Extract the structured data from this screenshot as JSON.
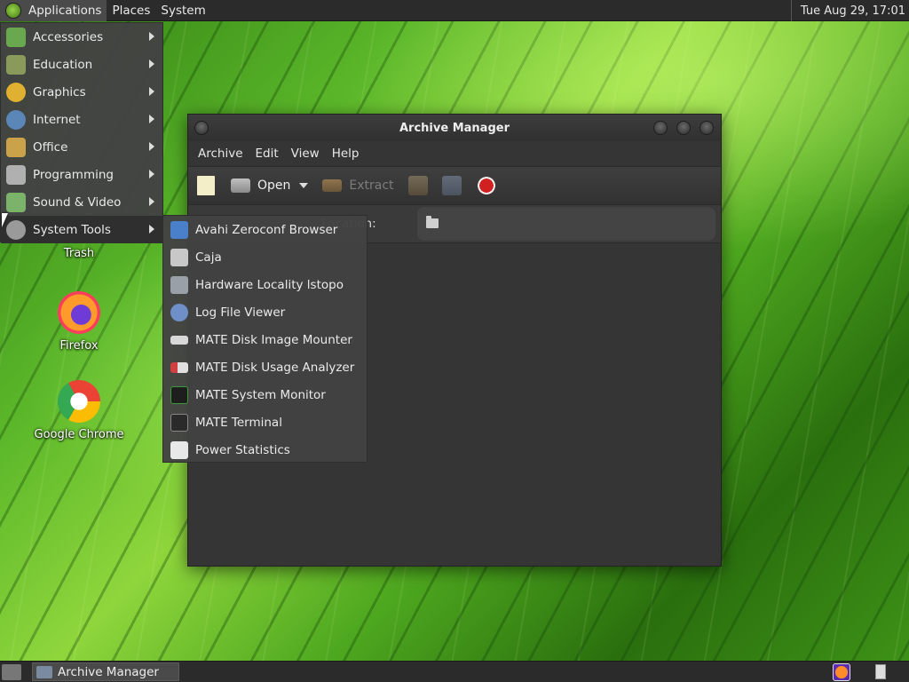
{
  "top_panel": {
    "menus": [
      "Applications",
      "Places",
      "System"
    ],
    "clock": "Tue Aug 29, 17:01"
  },
  "desktop_icons": {
    "trash": "Trash",
    "firefox": "Firefox",
    "chrome": "Google Chrome"
  },
  "app_menu": {
    "items": [
      {
        "label": "Accessories",
        "icon": "accessories-icon",
        "color": "#6aa84f"
      },
      {
        "label": "Education",
        "icon": "education-icon",
        "color": "#8a9a5b"
      },
      {
        "label": "Graphics",
        "icon": "graphics-icon",
        "color": "#e0b030"
      },
      {
        "label": "Internet",
        "icon": "internet-icon",
        "color": "#5b86b8"
      },
      {
        "label": "Office",
        "icon": "office-icon",
        "color": "#c9a24a"
      },
      {
        "label": "Programming",
        "icon": "programming-icon",
        "color": "#b0b0b0"
      },
      {
        "label": "Sound & Video",
        "icon": "sound-video-icon",
        "color": "#7bb36a"
      },
      {
        "label": "System Tools",
        "icon": "system-tools-icon",
        "color": "#9a9a9a"
      }
    ]
  },
  "submenu": {
    "items": [
      {
        "label": "Avahi Zeroconf Browser",
        "icon": "avahi-icon",
        "color": "#4a7fc9"
      },
      {
        "label": "Caja",
        "icon": "caja-icon",
        "color": "#c8c8c8"
      },
      {
        "label": "Hardware Locality lstopo",
        "icon": "hardware-icon",
        "color": "#9aa0a8"
      },
      {
        "label": "Log File Viewer",
        "icon": "log-viewer-icon",
        "color": "#6f8fc9"
      },
      {
        "label": "MATE Disk Image Mounter",
        "icon": "disk-mounter-icon",
        "color": "#d8d8d8"
      },
      {
        "label": "MATE Disk Usage Analyzer",
        "icon": "disk-usage-icon",
        "color": "#d04040"
      },
      {
        "label": "MATE System Monitor",
        "icon": "system-monitor-icon",
        "color": "#3c9a3c"
      },
      {
        "label": "MATE Terminal",
        "icon": "terminal-icon",
        "color": "#2a2a2a"
      },
      {
        "label": "Power Statistics",
        "icon": "power-stats-icon",
        "color": "#e8e8e8"
      }
    ]
  },
  "window": {
    "title": "Archive Manager",
    "menus": [
      "Archive",
      "Edit",
      "View",
      "Help"
    ],
    "toolbar": {
      "open_label": "Open",
      "extract_label": "Extract"
    },
    "location_label": "Location:"
  },
  "bottom_panel": {
    "task_label": "Archive Manager"
  }
}
